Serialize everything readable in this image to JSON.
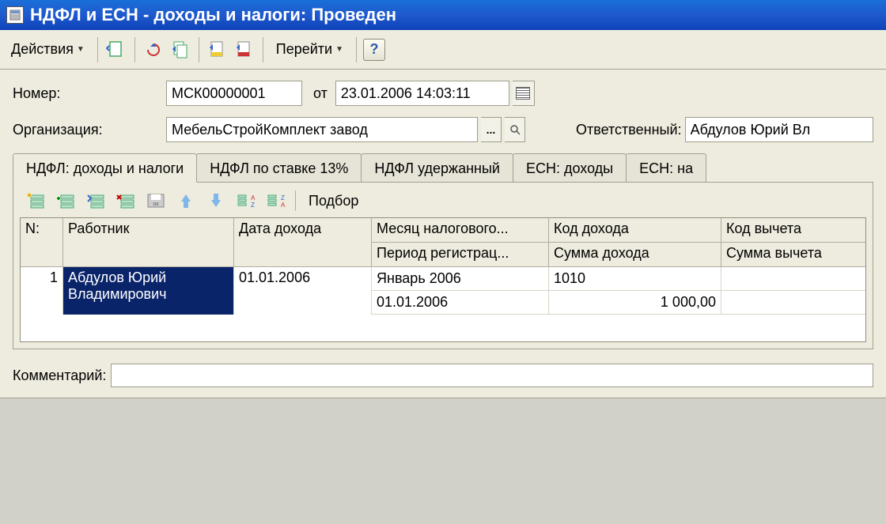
{
  "window": {
    "title": "НДФЛ и ЕСН - доходы и налоги: Проведен"
  },
  "toolbar": {
    "actions_label": "Действия",
    "goto_label": "Перейти"
  },
  "form": {
    "number_label": "Номер:",
    "number_value": "МСК00000001",
    "ot_label": "от",
    "date_value": "23.01.2006 14:03:11",
    "org_label": "Организация:",
    "org_value": "МебельСтройКомплект завод",
    "resp_label": "Ответственный:",
    "resp_value": "Абдулов Юрий Вл",
    "comment_label": "Комментарий:",
    "comment_value": ""
  },
  "tabs": [
    {
      "label": "НДФЛ: доходы и налоги",
      "active": true
    },
    {
      "label": "НДФЛ по ставке 13%",
      "active": false
    },
    {
      "label": "НДФЛ удержанный",
      "active": false
    },
    {
      "label": "ЕСН: доходы",
      "active": false
    },
    {
      "label": "ЕСН: на",
      "active": false
    }
  ],
  "table_toolbar": {
    "podbor_label": "Подбор"
  },
  "grid": {
    "headers": {
      "n": "N:",
      "worker": "Работник",
      "income_date": "Дата дохода",
      "tax_month": "Месяц налогового...",
      "reg_period": "Период регистрац...",
      "income_code": "Код дохода",
      "income_sum": "Сумма дохода",
      "ded_code": "Код вычета",
      "ded_sum": "Сумма вычета"
    },
    "rows": [
      {
        "n": "1",
        "worker": "Абдулов Юрий Владимирович",
        "income_date": "01.01.2006",
        "tax_month": "Январь 2006",
        "reg_period": "01.01.2006",
        "income_code": "1010",
        "income_sum": "1 000,00",
        "ded_code": "",
        "ded_sum": ""
      }
    ]
  }
}
